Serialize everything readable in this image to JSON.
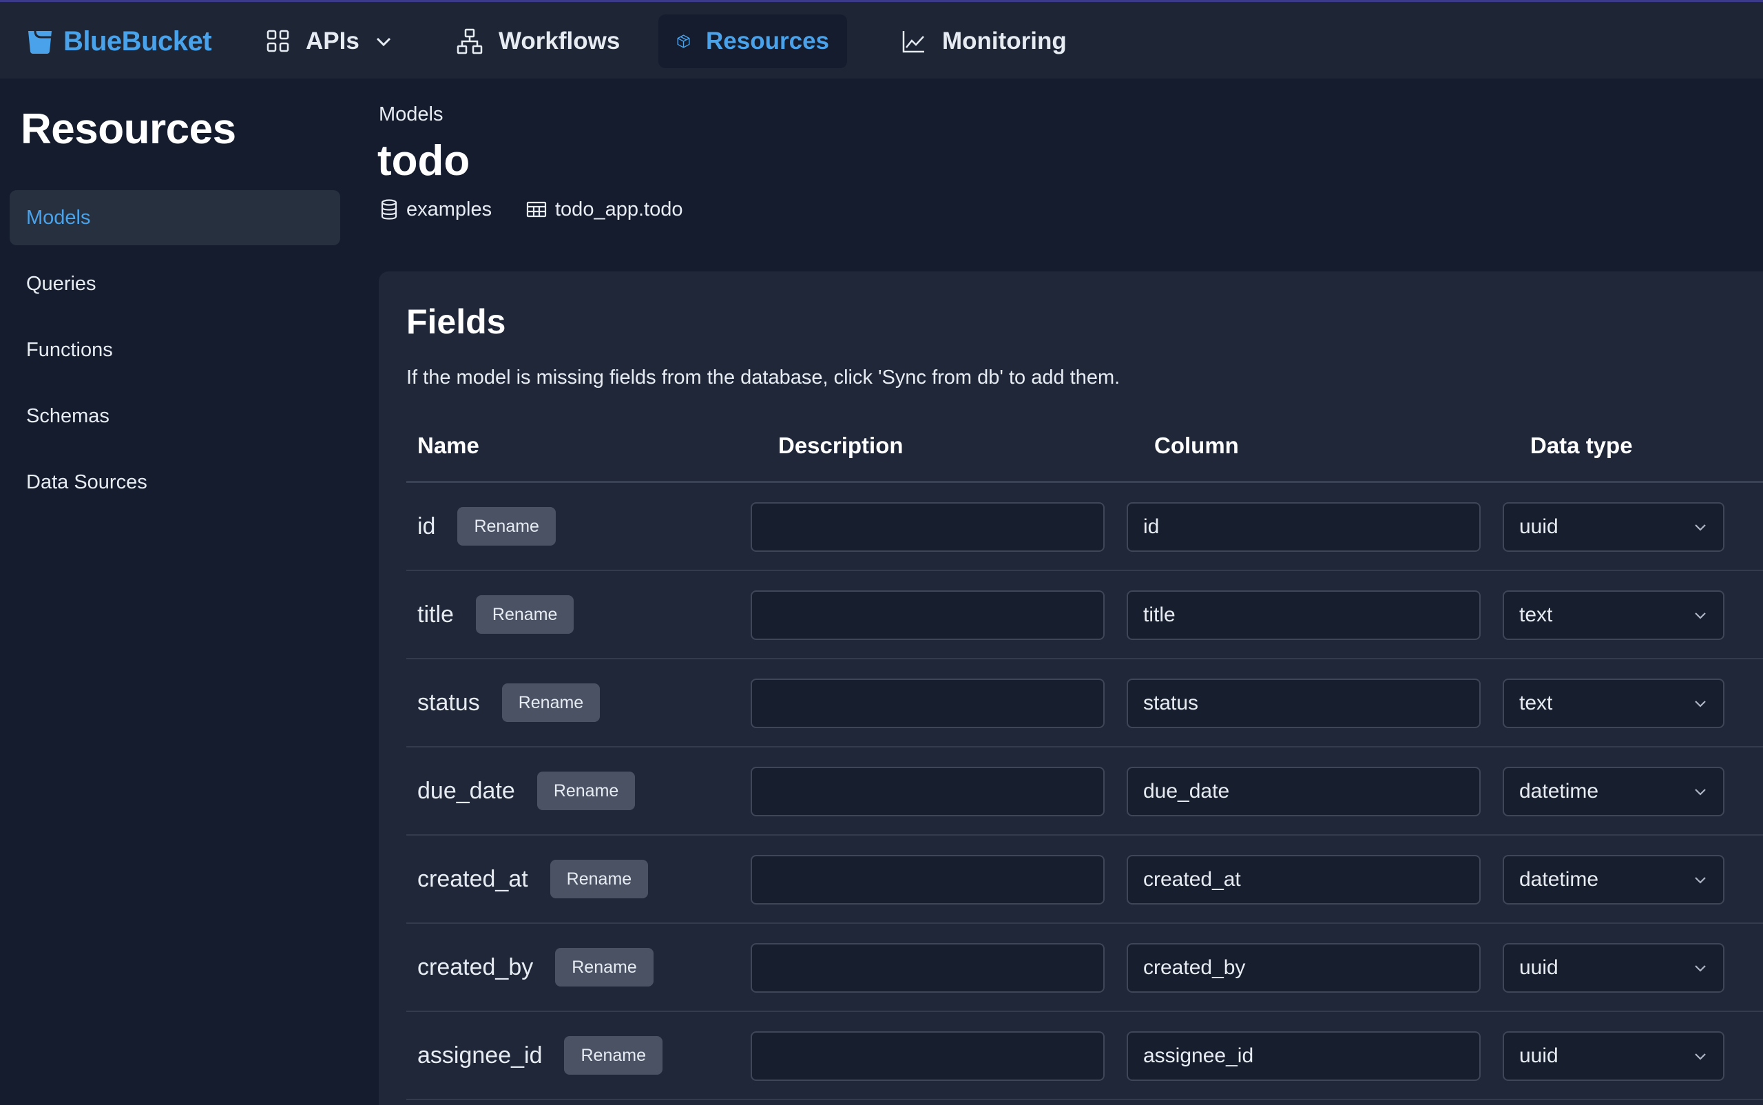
{
  "brand": {
    "name": "BlueBucket",
    "accent": "#4aa3ea"
  },
  "nav": {
    "items": [
      {
        "label": "APIs",
        "icon": "grid-icon",
        "has_dropdown": true
      },
      {
        "label": "Workflows",
        "icon": "workflow-icon"
      },
      {
        "label": "Resources",
        "icon": "cube-icon",
        "active": true
      },
      {
        "label": "Monitoring",
        "icon": "chart-icon"
      }
    ]
  },
  "sidebar": {
    "title": "Resources",
    "items": [
      {
        "label": "Models",
        "active": true
      },
      {
        "label": "Queries"
      },
      {
        "label": "Functions"
      },
      {
        "label": "Schemas"
      },
      {
        "label": "Data Sources"
      }
    ]
  },
  "header": {
    "breadcrumb": "Models",
    "title": "todo",
    "database": "examples",
    "table": "todo_app.todo"
  },
  "fields": {
    "title": "Fields",
    "description": "If the model is missing fields from the database, click 'Sync from db' to add them.",
    "columns": [
      "Name",
      "Description",
      "Column",
      "Data type"
    ],
    "rename_label": "Rename",
    "rows": [
      {
        "name": "id",
        "description": "",
        "column": "id",
        "data_type": "uuid"
      },
      {
        "name": "title",
        "description": "",
        "column": "title",
        "data_type": "text"
      },
      {
        "name": "status",
        "description": "",
        "column": "status",
        "data_type": "text"
      },
      {
        "name": "due_date",
        "description": "",
        "column": "due_date",
        "data_type": "datetime"
      },
      {
        "name": "created_at",
        "description": "",
        "column": "created_at",
        "data_type": "datetime"
      },
      {
        "name": "created_by",
        "description": "",
        "column": "created_by",
        "data_type": "uuid"
      },
      {
        "name": "assignee_id",
        "description": "",
        "column": "assignee_id",
        "data_type": "uuid"
      }
    ]
  }
}
